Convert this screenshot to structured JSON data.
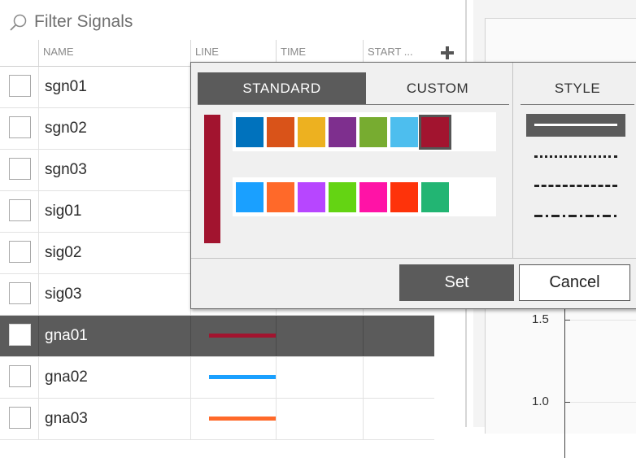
{
  "filter": {
    "placeholder": "Filter Signals"
  },
  "table": {
    "headers": {
      "name": "NAME",
      "line": "LINE",
      "time": "TIME",
      "start": "START ..."
    },
    "rows": [
      {
        "name": "sgn01",
        "line_color": null,
        "selected": false
      },
      {
        "name": "sgn02",
        "line_color": null,
        "selected": false
      },
      {
        "name": "sgn03",
        "line_color": null,
        "selected": false
      },
      {
        "name": "sig01",
        "line_color": null,
        "selected": false
      },
      {
        "name": "sig02",
        "line_color": null,
        "selected": false
      },
      {
        "name": "sig03",
        "line_color": null,
        "selected": false
      },
      {
        "name": "gna01",
        "line_color": "#a2142f",
        "selected": true
      },
      {
        "name": "gna02",
        "line_color": "#1aa0ff",
        "selected": false
      },
      {
        "name": "gna03",
        "line_color": "#ff6929",
        "selected": false
      }
    ]
  },
  "popup": {
    "tab_standard": "STANDARD",
    "tab_custom": "CUSTOM",
    "style_title": "STYLE",
    "current_color": "#a2142f",
    "palette_row1": [
      "#0072bd",
      "#d95319",
      "#edb120",
      "#7e2f8e",
      "#77ac30",
      "#4dbeee",
      "#a2142f"
    ],
    "palette_row2": [
      "#1aa0ff",
      "#ff6929",
      "#b746ff",
      "#64d413",
      "#ff13a6",
      "#fe330a",
      "#22b573"
    ],
    "selected_swatch": "#a2142f",
    "styles": [
      "solid",
      "dotted",
      "dashed",
      "dash-dot"
    ],
    "selected_style": "solid",
    "set_label": "Set",
    "cancel_label": "Cancel"
  },
  "plot": {
    "y_ticks": [
      "1.5",
      "1.0"
    ]
  }
}
